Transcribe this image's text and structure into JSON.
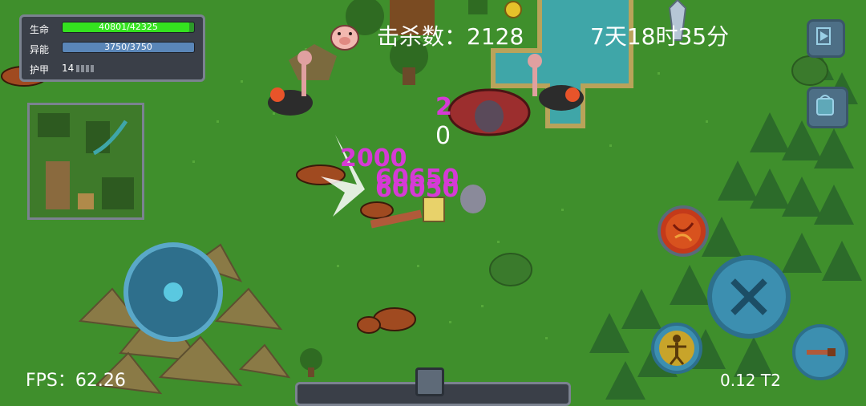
{
  "hud": {
    "hp_label": "生命",
    "hp_value": "40801/42325",
    "hp_fraction": 0.964,
    "energy_label": "异能",
    "energy_value": "3750/3750",
    "armor_label": "护甲",
    "armor_value": "14",
    "kills_text": "击杀数：2128",
    "time_text": "7天18时35分",
    "fps_text": "FPS：62.26",
    "version_text": "0.12 T2"
  },
  "damage": {
    "d1": "2",
    "d2": "0",
    "d3": "2000",
    "d4": "60650",
    "d5": "60050"
  },
  "icons": {
    "pause": "pause-icon",
    "bag": "backpack-icon",
    "attack": "crossed-swords-icon",
    "skill_fire": "fire-orb-icon",
    "skill_body": "figure-icon",
    "weapon": "rifle-icon",
    "pig": "pig-icon"
  },
  "colors": {
    "grass": "#3f8f2c",
    "hp": "#34e21f",
    "energy": "#5a86b8",
    "damage": "#d63ad6"
  }
}
